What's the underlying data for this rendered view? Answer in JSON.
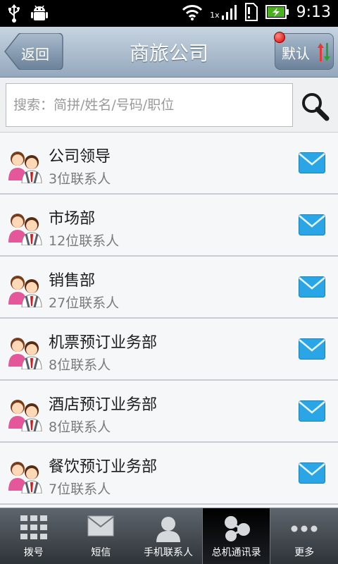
{
  "status_bar": {
    "network_label": "1x",
    "time": "9:13"
  },
  "header": {
    "back_label": "返回",
    "title": "商旅公司",
    "sort_label": "默认"
  },
  "search": {
    "placeholder": "搜索：简拼/姓名/号码/职位"
  },
  "departments": [
    {
      "name": "公司领导",
      "count": "3位联系人"
    },
    {
      "name": "市场部",
      "count": "12位联系人"
    },
    {
      "name": "销售部",
      "count": "27位联系人"
    },
    {
      "name": "机票预订业务部",
      "count": "8位联系人"
    },
    {
      "name": "酒店预订业务部",
      "count": "8位联系人"
    },
    {
      "name": "餐饮预订业务部",
      "count": "7位联系人"
    }
  ],
  "bottom_nav": {
    "items": [
      {
        "label": "拨号",
        "icon": "dialpad-icon"
      },
      {
        "label": "短信",
        "icon": "envelope-icon"
      },
      {
        "label": "手机联系人",
        "icon": "person-icon"
      },
      {
        "label": "总机通讯录",
        "icon": "network-icon",
        "active": true
      },
      {
        "label": "更多",
        "icon": "more-dots-icon"
      }
    ]
  },
  "colors": {
    "mail_blue": "#2aa6e6",
    "header_top": "#c7d4e1",
    "header_bottom": "#94a8bd",
    "active_tab": "#000000"
  }
}
